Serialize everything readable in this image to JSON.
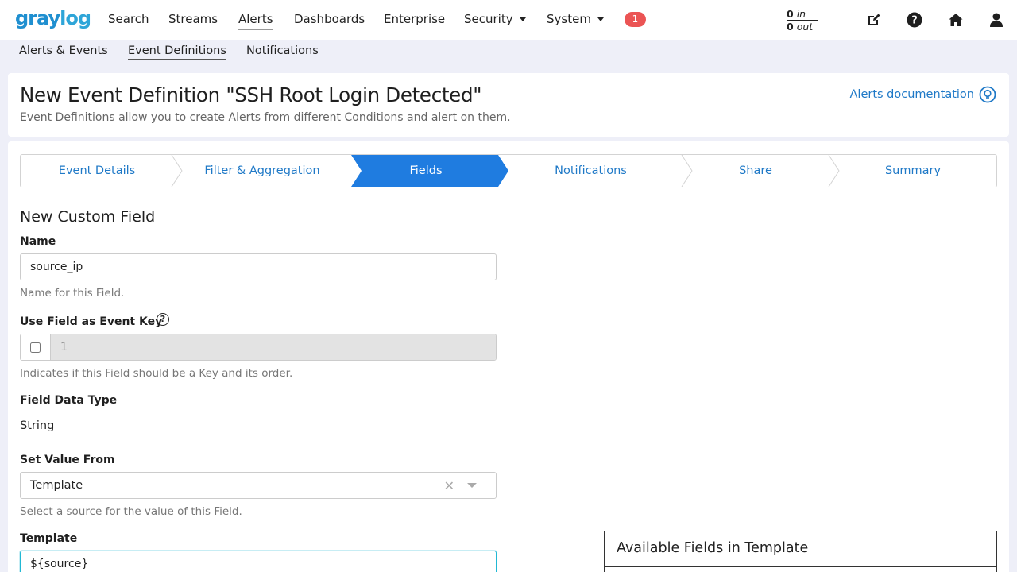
{
  "colors": {
    "brand": "#1f8fd0",
    "link": "#1f79c7",
    "active_step": "#1f7ce0",
    "badge": "#eb5454",
    "focus": "#21b8d4"
  },
  "navbar": {
    "logo": {
      "part1": "gray",
      "part2": "log"
    },
    "items": [
      {
        "label": "Search"
      },
      {
        "label": "Streams"
      },
      {
        "label": "Alerts"
      },
      {
        "label": "Dashboards"
      },
      {
        "label": "Enterprise"
      },
      {
        "label": "Security"
      },
      {
        "label": "System"
      }
    ],
    "notification_count": "1",
    "throughput": {
      "in_value": "0",
      "in_label": "in",
      "out_value": "0",
      "out_label": "out"
    },
    "icons": [
      "edit-icon",
      "help-icon",
      "home-icon",
      "user-icon"
    ]
  },
  "subnav": {
    "items": [
      {
        "label": "Alerts & Events"
      },
      {
        "label": "Event Definitions"
      },
      {
        "label": "Notifications"
      }
    ]
  },
  "header": {
    "title": "New Event Definition \"SSH Root Login Detected\"",
    "description": "Event Definitions allow you to create Alerts from different Conditions and alert on them.",
    "doc_link": "Alerts documentation"
  },
  "wizard": {
    "steps": [
      {
        "label": "Event Details"
      },
      {
        "label": "Filter & Aggregation"
      },
      {
        "label": "Fields"
      },
      {
        "label": "Notifications"
      },
      {
        "label": "Share"
      },
      {
        "label": "Summary"
      }
    ],
    "active_step": "Fields"
  },
  "form": {
    "section_title": "New Custom Field",
    "name": {
      "label": "Name",
      "value": "source_ip",
      "help": "Name for this Field."
    },
    "event_key": {
      "label": "Use Field as Event Key",
      "checked": false,
      "order_value": "1",
      "help": "Indicates if this Field should be a Key and its order."
    },
    "data_type": {
      "label": "Field Data Type",
      "value": "String"
    },
    "set_value_from": {
      "label": "Set Value From",
      "value": "Template",
      "clear_glyph": "✕",
      "help": "Select a source for the value of this Field."
    },
    "template": {
      "label": "Template",
      "value": "${source}"
    }
  },
  "available_fields": {
    "title": "Available Fields in Template"
  }
}
